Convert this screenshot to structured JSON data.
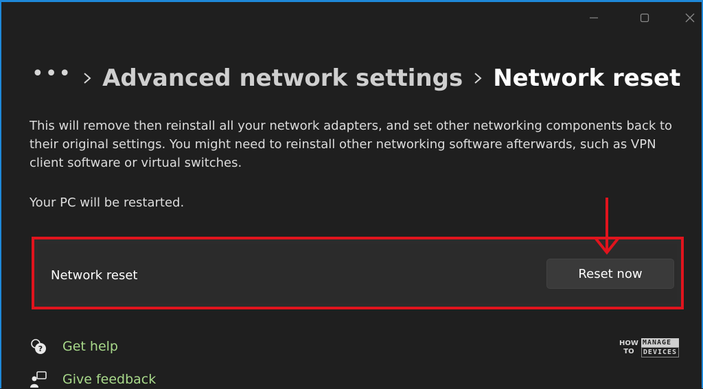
{
  "window": {
    "controls": {
      "minimize_icon": "minimize-icon",
      "maximize_icon": "maximize-icon",
      "close_icon": "close-icon"
    }
  },
  "breadcrumb": {
    "more": "•••",
    "items": [
      "Advanced network settings",
      "Network reset"
    ]
  },
  "main": {
    "description": "This will remove then reinstall all your network adapters, and set other networking components back to their original settings. You might need to reinstall other networking software afterwards, such as VPN client software or virtual switches.",
    "restart_note": "Your PC will be restarted.",
    "card": {
      "label": "Network reset",
      "button_label": "Reset now"
    }
  },
  "links": {
    "help": "Get help",
    "feedback": "Give feedback"
  },
  "watermark": {
    "how": "HOW",
    "to": "TO",
    "manage": "MANAGE",
    "devices": "DEVICES"
  },
  "colors": {
    "accent_border": "#1e88d8",
    "highlight": "#e0141d",
    "link": "#a8d98a",
    "background": "#1f1f1f"
  }
}
